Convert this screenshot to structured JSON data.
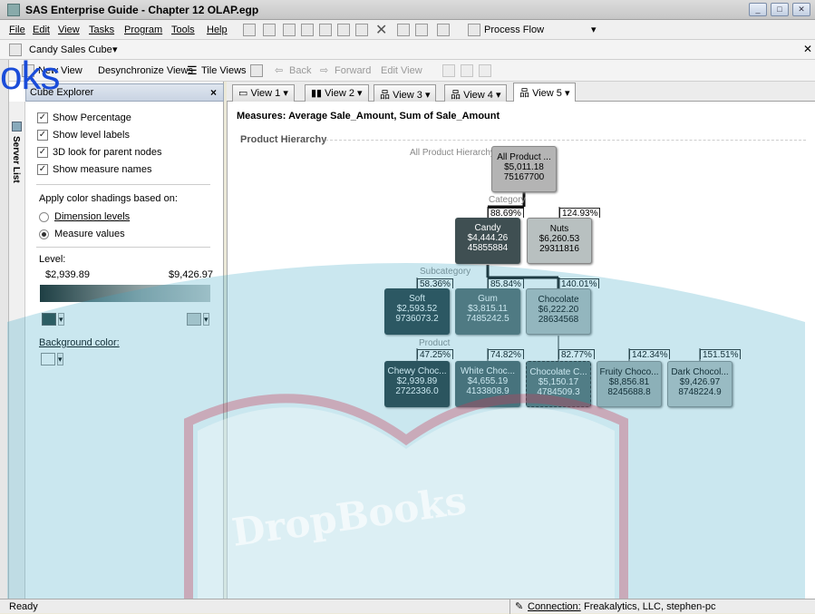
{
  "window": {
    "title": "SAS Enterprise Guide - Chapter 12 OLAP.egp"
  },
  "menu": [
    "File",
    "Edit",
    "View",
    "Tasks",
    "Program",
    "Tools",
    "Help"
  ],
  "process_flow_label": "Process Flow",
  "document": {
    "title": "Candy Sales Cube"
  },
  "toolbar": {
    "new_view": "New View",
    "desync": "Desynchronize Views",
    "tile": "Tile Views",
    "back": "Back",
    "forward": "Forward",
    "edit_view": "Edit View"
  },
  "panel": {
    "title": "Cube Explorer",
    "options": [
      {
        "label": "Show Percentage",
        "checked": true
      },
      {
        "label": "Show level labels",
        "checked": true
      },
      {
        "label": "3D look for parent nodes",
        "checked": true
      },
      {
        "label": "Show measure names",
        "checked": true
      }
    ],
    "shading_label": "Apply color shadings based on:",
    "shading_options": [
      {
        "label": "Dimension levels",
        "selected": false
      },
      {
        "label": "Measure values",
        "selected": true
      }
    ],
    "level_label": "Level:",
    "range_min": "$2,939.89",
    "range_max": "$9,426.97",
    "background_label": "Background color:"
  },
  "side_tabs": [
    "Server List"
  ],
  "tabs": [
    "View 1",
    "View 2",
    "View 3",
    "View 4",
    "View 5"
  ],
  "active_tab": "View 5",
  "view": {
    "measures": "Measures:  Average Sale_Amount, Sum of Sale_Amount",
    "hierarchy_group": "Product Hierarchy",
    "levels": {
      "root": "All Product Hierarchy",
      "category": "Category",
      "subcategory": "Subcategory",
      "product": "Product"
    },
    "nodes": {
      "root": {
        "name": "All Product ...",
        "avg": "$5,011.18",
        "sum": "75167700"
      },
      "candy": {
        "name": "Candy",
        "avg": "$4,444.26",
        "sum": "45855884",
        "pct": "88.69%"
      },
      "nuts": {
        "name": "Nuts",
        "avg": "$6,260.53",
        "sum": "29311816",
        "pct": "124.93%"
      },
      "soft": {
        "name": "Soft",
        "avg": "$2,593.52",
        "sum": "9736073.2",
        "pct": "58.36%"
      },
      "gum": {
        "name": "Gum",
        "avg": "$3,815.11",
        "sum": "7485242.5",
        "pct": "85.84%"
      },
      "chocolate": {
        "name": "Chocolate",
        "avg": "$6,222.20",
        "sum": "28634568",
        "pct": "140.01%"
      },
      "chewy": {
        "name": "Chewy Choc...",
        "avg": "$2,939.89",
        "sum": "2722336.0",
        "pct": "47.25%"
      },
      "white": {
        "name": "White Choc...",
        "avg": "$4,655.19",
        "sum": "4133808.9",
        "pct": "74.82%"
      },
      "chocc": {
        "name": "Chocolate C...",
        "avg": "$5,150.17",
        "sum": "4784509.3",
        "pct": "82.77%"
      },
      "fruity": {
        "name": "Fruity Choco...",
        "avg": "$8,856.81",
        "sum": "8245688.8",
        "pct": "142.34%"
      },
      "dark": {
        "name": "Dark Chocol...",
        "avg": "$9,426.97",
        "sum": "8748224.9",
        "pct": "151.51%"
      }
    }
  },
  "status": {
    "text": "Ready",
    "connection_label": "Connection:",
    "connection_value": "Freakalytics, LLC, stephen-pc"
  },
  "watermark": {
    "text": "DropBooks",
    "corner": "oks"
  }
}
